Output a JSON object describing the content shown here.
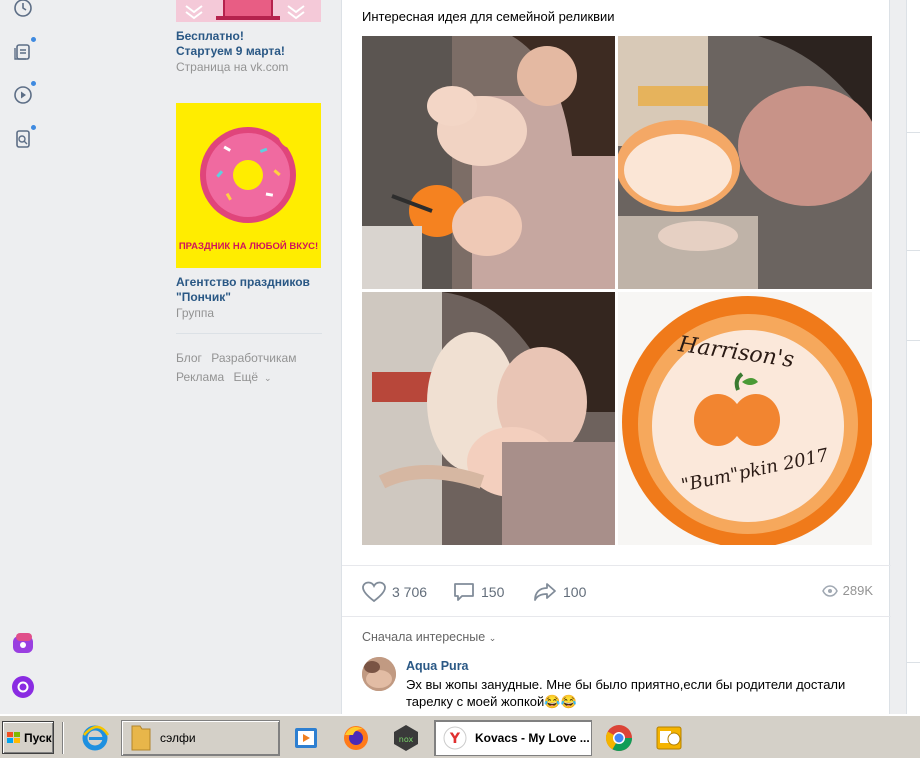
{
  "ads": {
    "ad1": {
      "title_line1": "Бесплатно!",
      "title_line2": "Стартуем 9 марта!",
      "subtitle": "Страница на vk.com"
    },
    "ad2": {
      "banner_text": "ПРАЗДНИК НА ЛЮБОЙ ВКУС!",
      "title_line1": "Агентство праздников",
      "title_line2": "\"Пончик\"",
      "subtitle": "Группа"
    },
    "footer_links": [
      "Блог",
      "Разработчикам",
      "Реклама",
      "Ещё"
    ]
  },
  "post": {
    "text": "Интересная идея для семейной реликвии",
    "plate_text_1": "Harrison's",
    "plate_text_2": "\"Bum\"pkin 2017",
    "likes": "3 706",
    "comments": "150",
    "shares": "100",
    "views": "289K"
  },
  "comments": {
    "sort_label": "Сначала интересные",
    "items": [
      {
        "author": "Aqua Pura",
        "text": "Эх вы жопы занудные. Мне бы было приятно,если бы родители достали тарелку с моей жопкой😂😂"
      }
    ]
  },
  "taskbar": {
    "start_label": "Пуск",
    "folder_label": "сэлфи",
    "browser_label": "Kovacs - My Love ..."
  },
  "colors": {
    "accent": "#2a5885",
    "dot": "#3f8ae0",
    "yellow": "#ffed00",
    "orange": "#f07a1a"
  }
}
